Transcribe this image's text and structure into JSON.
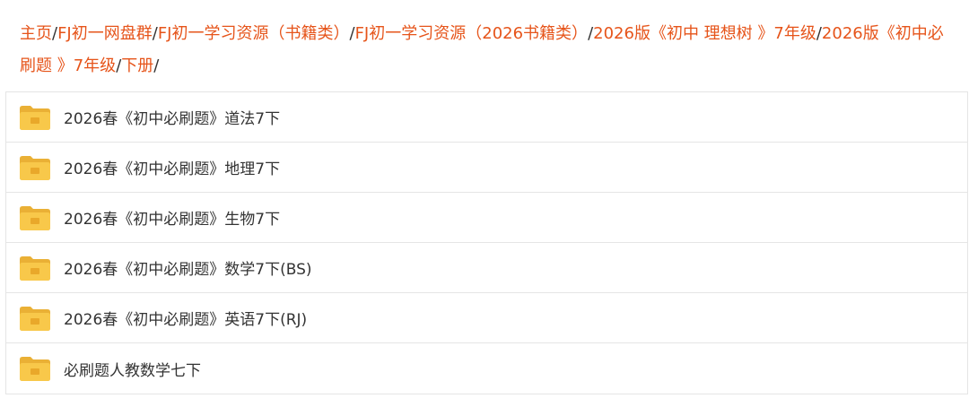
{
  "breadcrumb": {
    "items": [
      {
        "label": "主页"
      },
      {
        "label": "FJ初一网盘群"
      },
      {
        "label": "FJ初一学习资源（书籍类）"
      },
      {
        "label": "FJ初一学习资源（2026书籍类）"
      },
      {
        "label": "2026版《初中 理想树 》7年级"
      },
      {
        "label": "2026版《初中必刷题 》7年级"
      },
      {
        "label": "下册"
      }
    ],
    "separator": "/"
  },
  "folders": [
    {
      "name": "2026春《初中必刷题》道法7下",
      "icon": "folder-icon"
    },
    {
      "name": "2026春《初中必刷题》地理7下",
      "icon": "folder-icon"
    },
    {
      "name": "2026春《初中必刷题》生物7下",
      "icon": "folder-icon"
    },
    {
      "name": "2026春《初中必刷题》数学7下(BS)",
      "icon": "folder-icon"
    },
    {
      "name": "2026春《初中必刷题》英语7下(RJ)",
      "icon": "folder-icon"
    },
    {
      "name": "必刷题人教数学七下",
      "icon": "folder-icon"
    }
  ],
  "colors": {
    "link": "#e6541a",
    "folder": "#f8c84a",
    "folder_dark": "#eab035",
    "folder_tab": "#e9a82a"
  }
}
